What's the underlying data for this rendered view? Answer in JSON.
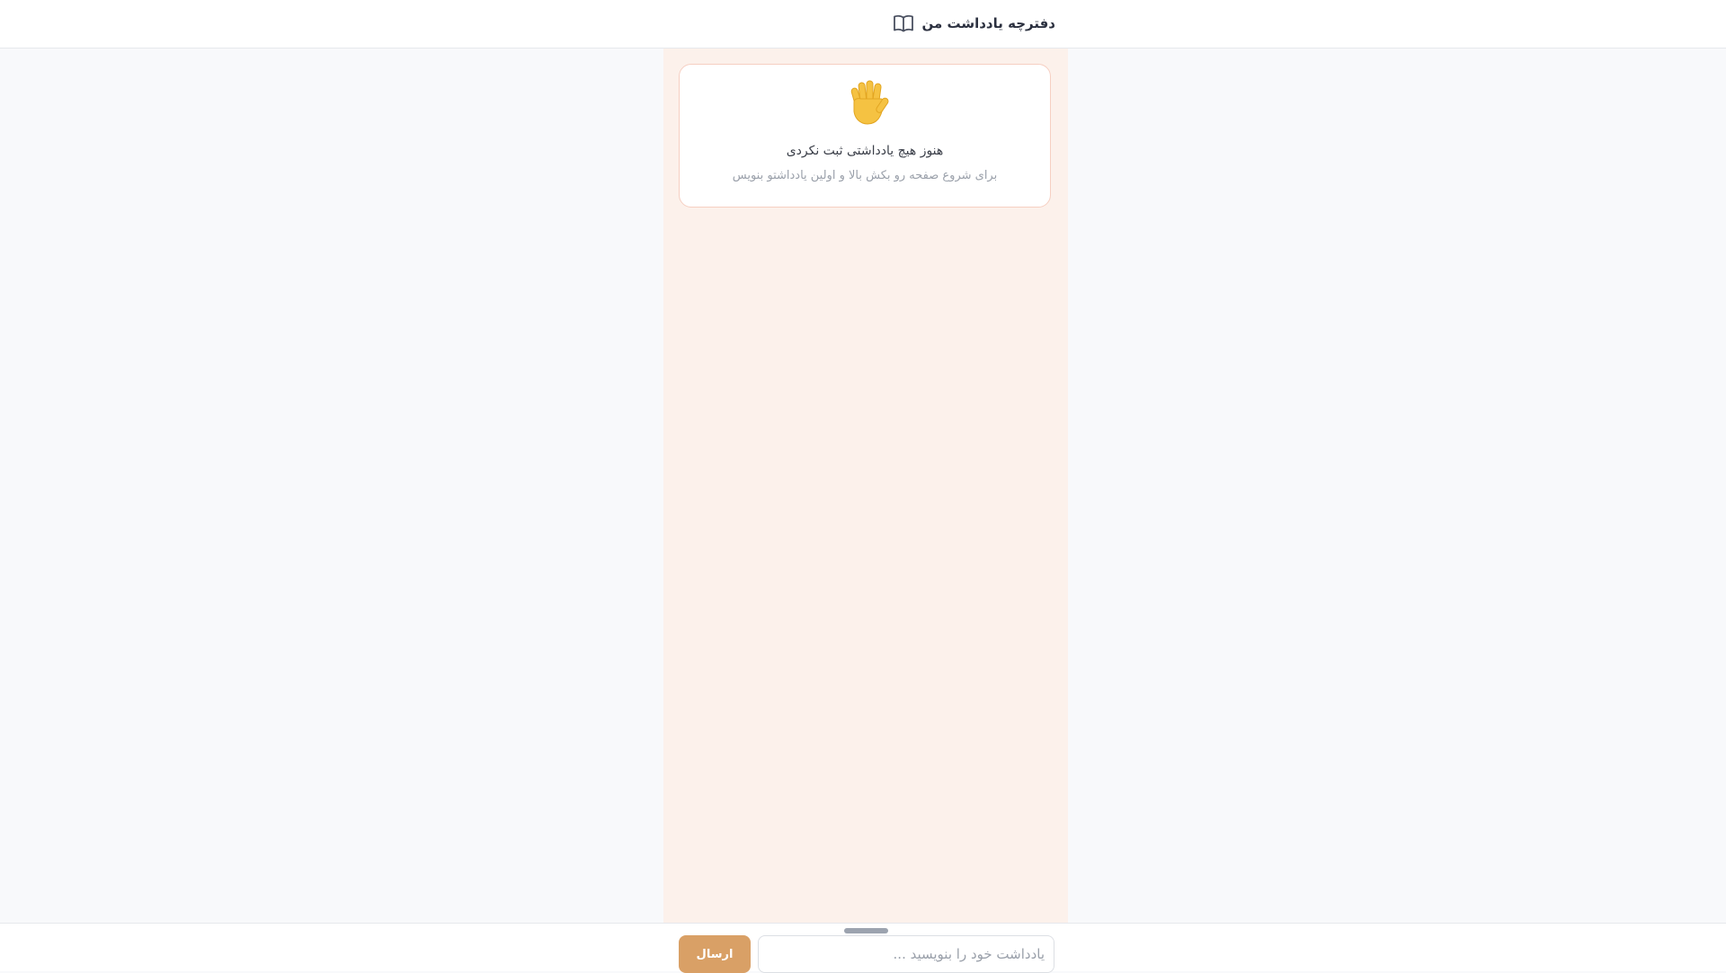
{
  "header": {
    "title": "دفترچه یادداشت من",
    "icon": "book-open-icon"
  },
  "empty_state": {
    "icon": "waving-hand-icon",
    "title": "هنوز هیچ یادداشتی ثبت نکردی",
    "subtitle": "برای شروع صفحه رو بکش بالا و اولین یادداشتو بنویس"
  },
  "composer": {
    "placeholder": "یادداشت خود را بنویسید ...",
    "value": "",
    "send_label": "ارسال"
  },
  "colors": {
    "accent": "#d9a066",
    "panel_bg": "#fcf1eb",
    "card_border": "#f6cfc2",
    "page_bg": "#f8f9fb"
  }
}
